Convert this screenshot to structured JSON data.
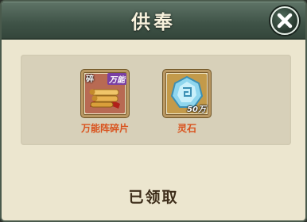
{
  "dialog": {
    "title": "供奉",
    "status": "已领取"
  },
  "close_button": {
    "icon": "close-icon"
  },
  "rewards": [
    {
      "name": "万能阵碎片",
      "icon": "scroll-fragment-icon",
      "tag_fragment": "碎",
      "tag_universal": "万能",
      "quantity": ""
    },
    {
      "name": "灵石",
      "icon": "spirit-stone-icon",
      "quantity": "50万"
    }
  ],
  "colors": {
    "title_bar": "#3f5347",
    "background": "#ece6cf",
    "panel": "#d7d0b9",
    "item_name": "#d9531e",
    "status_text": "#3d2d1a"
  }
}
